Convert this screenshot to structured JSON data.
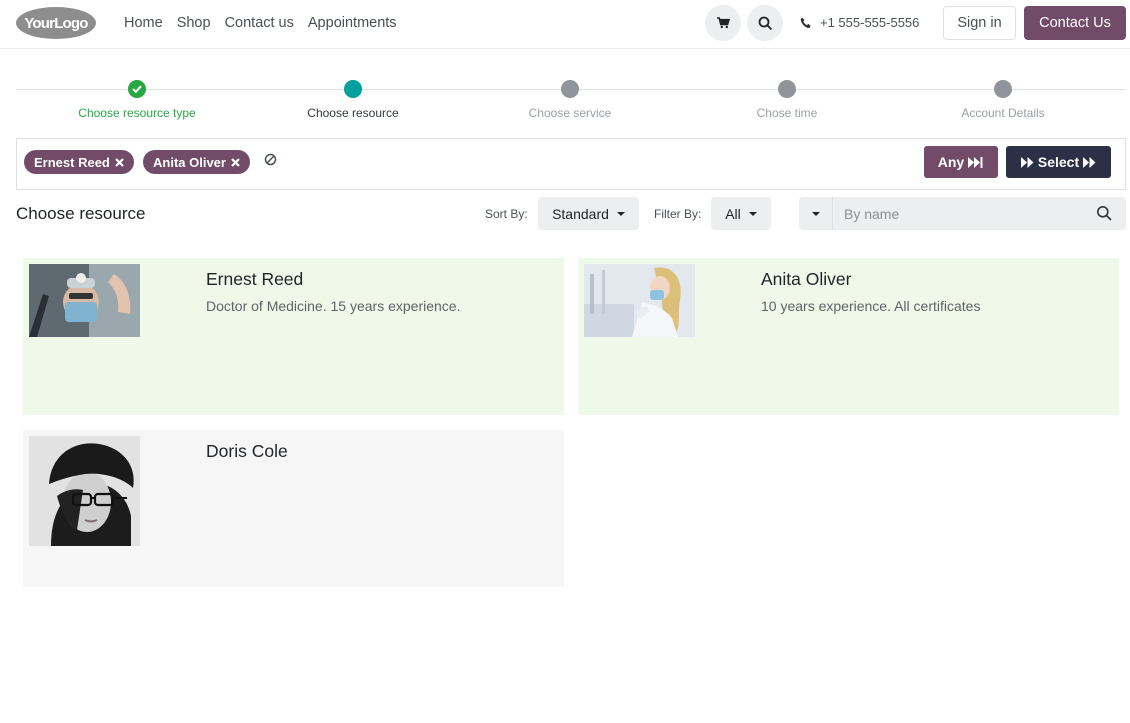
{
  "header": {
    "logo_text": "YourLogo",
    "nav": [
      "Home",
      "Shop",
      "Contact us",
      "Appointments"
    ],
    "phone": "+1 555-555-5556",
    "signin_label": "Sign in",
    "contact_label": "Contact Us"
  },
  "steps": [
    {
      "label": "Choose resource type",
      "state": "done"
    },
    {
      "label": "Choose resource",
      "state": "active"
    },
    {
      "label": "Choose service",
      "state": "pending"
    },
    {
      "label": "Chose time",
      "state": "pending"
    },
    {
      "label": "Account Details",
      "state": "pending"
    }
  ],
  "selection": {
    "tags": [
      "Ernest Reed",
      "Anita Oliver"
    ],
    "any_label": "Any",
    "select_label": "Select"
  },
  "toolbar": {
    "title": "Choose resource",
    "sort_label": "Sort By:",
    "sort_value": "Standard",
    "filter_label": "Filter By:",
    "filter_value": "All",
    "search_placeholder": "By name"
  },
  "resources": [
    {
      "name": "Ernest Reed",
      "description": "Doctor of Medicine. 15 years experience.",
      "selected": true
    },
    {
      "name": "Anita Oliver",
      "description": "10 years experience. All certificates",
      "selected": true
    },
    {
      "name": "Doris Cole",
      "description": "",
      "selected": false
    }
  ],
  "colors": {
    "brand": "#714b67",
    "dark": "#2c3046",
    "done": "#28a745",
    "active": "#00a09d",
    "selected_card": "#eff9e9"
  }
}
